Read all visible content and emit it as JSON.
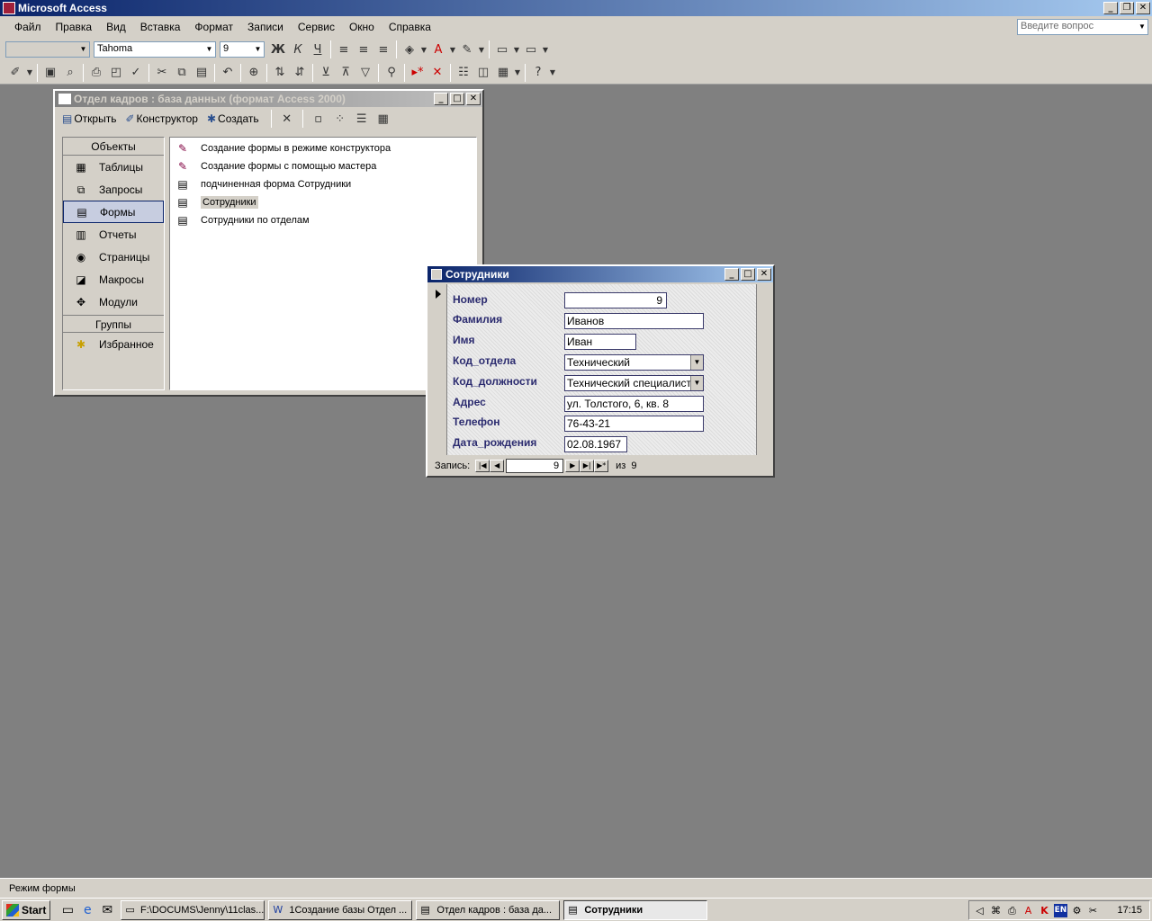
{
  "app": {
    "title": "Microsoft Access"
  },
  "menu": [
    "Файл",
    "Правка",
    "Вид",
    "Вставка",
    "Формат",
    "Записи",
    "Сервис",
    "Окно",
    "Справка"
  ],
  "help_box": {
    "placeholder": "Введите вопрос"
  },
  "format_toolbar": {
    "object_combo": "",
    "font": "Tahoma",
    "size": "9"
  },
  "db_window": {
    "title": "Отдел кадров : база данных (формат Access 2000)",
    "toolbar": {
      "open": "Открыть",
      "design": "Конструктор",
      "create": "Создать"
    },
    "objects_header": "Объекты",
    "objects": [
      {
        "label": "Таблицы",
        "icon": "table-icon"
      },
      {
        "label": "Запросы",
        "icon": "query-icon"
      },
      {
        "label": "Формы",
        "icon": "form-icon",
        "selected": true
      },
      {
        "label": "Отчеты",
        "icon": "report-icon"
      },
      {
        "label": "Страницы",
        "icon": "page-icon"
      },
      {
        "label": "Макросы",
        "icon": "macro-icon"
      },
      {
        "label": "Модули",
        "icon": "module-icon"
      }
    ],
    "groups_header": "Группы",
    "groups": [
      {
        "label": "Избранное",
        "icon": "favorites-icon"
      }
    ],
    "items": [
      {
        "label": "Создание формы в режиме конструктора",
        "icon": "wizard-icon"
      },
      {
        "label": "Создание формы с помощью мастера",
        "icon": "wizard-icon"
      },
      {
        "label": "подчиненная форма Сотрудники",
        "icon": "form-icon"
      },
      {
        "label": "Сотрудники",
        "icon": "form-icon",
        "selected": true
      },
      {
        "label": "Сотрудники по отделам",
        "icon": "form-icon"
      }
    ]
  },
  "form_window": {
    "title": "Сотрудники",
    "fields": [
      {
        "label": "Номер",
        "value": "9"
      },
      {
        "label": "Фамилия",
        "value": "Иванов"
      },
      {
        "label": "Имя",
        "value": "Иван"
      },
      {
        "label": "Код_отдела",
        "value": "Технический"
      },
      {
        "label": "Код_должности",
        "value": "Технический специалист"
      },
      {
        "label": "Адрес",
        "value": "ул. Толстого, 6, кв. 8"
      },
      {
        "label": "Телефон",
        "value": "76-43-21"
      },
      {
        "label": "Дата_рождения",
        "value": "02.08.1967"
      }
    ],
    "nav": {
      "label": "Запись:",
      "current": "9",
      "of_label": "из",
      "total": "9"
    }
  },
  "status": {
    "text": "Режим формы"
  },
  "taskbar": {
    "start": "Start",
    "tasks": [
      {
        "label": "F:\\DOCUMS\\Jenny\\11clas...",
        "icon": "folder-icon"
      },
      {
        "label": "1Создание базы Отдел ...",
        "icon": "word-icon"
      },
      {
        "label": "Отдел кадров : база да...",
        "icon": "database-icon"
      },
      {
        "label": "Сотрудники",
        "icon": "form-icon",
        "active": true
      }
    ],
    "tray_lang": "EN",
    "clock": "17:15"
  }
}
